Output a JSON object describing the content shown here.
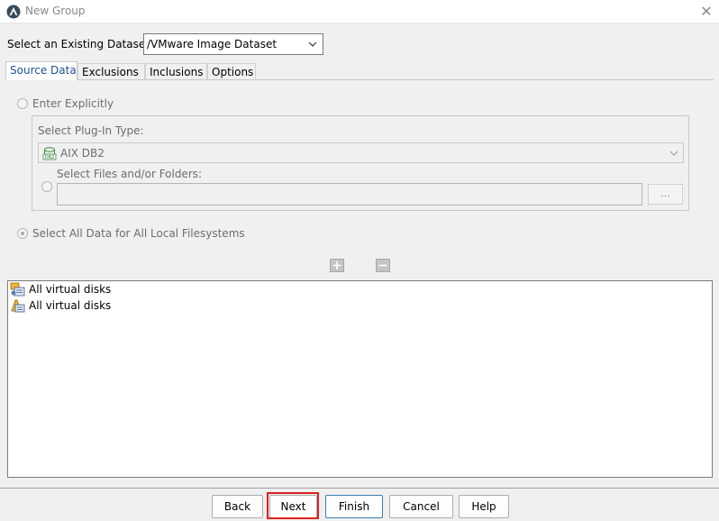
{
  "window": {
    "title": "New Group"
  },
  "dataset": {
    "label": "Select an Existing Dataset:",
    "value": "/VMware Image Dataset"
  },
  "tabs": [
    {
      "label": "Source Data",
      "active": true
    },
    {
      "label": "Exclusions",
      "active": false
    },
    {
      "label": "Inclusions",
      "active": false
    },
    {
      "label": "Options",
      "active": false
    }
  ],
  "source": {
    "enter_explicitly_label": "Enter Explicitly",
    "plugin_type_label": "Select Plug-In Type:",
    "plugin_type_value": "AIX DB2",
    "plugin_icon_text": "DB2",
    "files_label": "Select Files and/or Folders:",
    "files_value": "",
    "browse_label": "...",
    "select_all_label": "Select All Data for All Local Filesystems",
    "selected_mode": "select_all"
  },
  "items": [
    {
      "label": "All virtual disks"
    },
    {
      "label": "All virtual disks"
    }
  ],
  "buttons": {
    "back": "Back",
    "next": "Next",
    "finish": "Finish",
    "cancel": "Cancel",
    "help": "Help"
  },
  "colors": {
    "highlight": "#e02020",
    "active_tab_text": "#1b4f95"
  }
}
